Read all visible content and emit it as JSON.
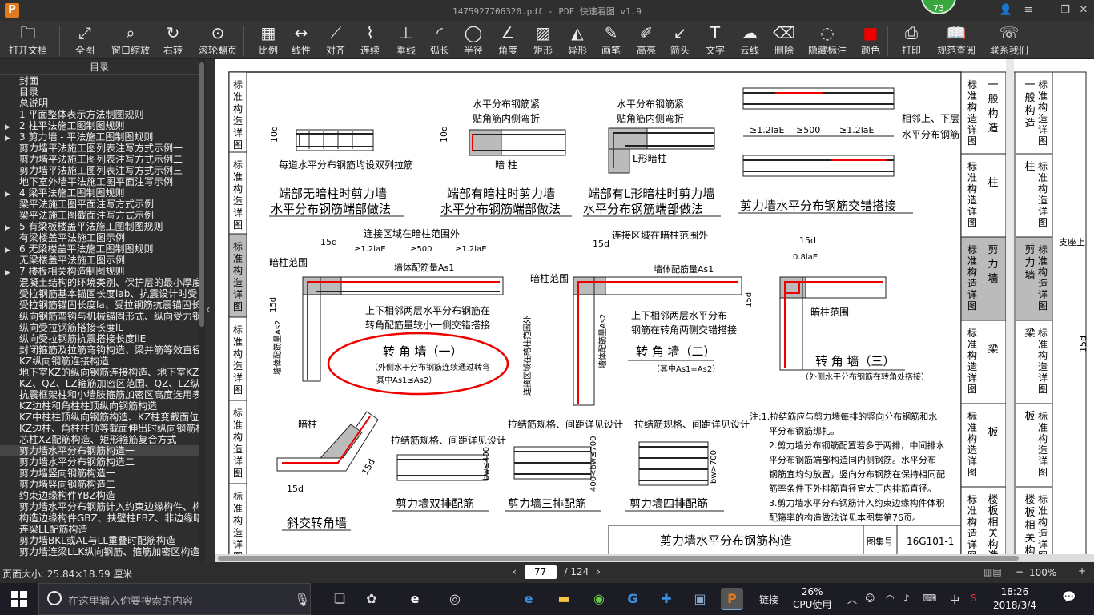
{
  "window": {
    "title": "1475927706320.pdf - PDF 快速看图 v1.9",
    "badge": "73"
  },
  "toolbar": [
    {
      "label": "打开文档",
      "icon": "folder-icon"
    },
    {
      "label": "全图",
      "icon": "fit-icon"
    },
    {
      "label": "窗口缩放",
      "icon": "zoom-icon"
    },
    {
      "label": "右转",
      "icon": "rotate-icon"
    },
    {
      "label": "滚轮翻页",
      "icon": "mouse-icon"
    },
    {
      "label": "比例",
      "icon": "ruler-icon"
    },
    {
      "label": "线性",
      "icon": "linear-icon"
    },
    {
      "label": "对齐",
      "icon": "align-icon"
    },
    {
      "label": "连续",
      "icon": "continuous-icon"
    },
    {
      "label": "垂线",
      "icon": "perpendicular-icon"
    },
    {
      "label": "弧长",
      "icon": "arc-icon"
    },
    {
      "label": "半径",
      "icon": "radius-icon"
    },
    {
      "label": "角度",
      "icon": "angle-icon"
    },
    {
      "label": "矩形",
      "icon": "rectangle-icon"
    },
    {
      "label": "异形",
      "icon": "polygon-icon"
    },
    {
      "label": "画笔",
      "icon": "pen-icon"
    },
    {
      "label": "高亮",
      "icon": "highlight-icon"
    },
    {
      "label": "箭头",
      "icon": "arrow-icon"
    },
    {
      "label": "文字",
      "icon": "text-icon"
    },
    {
      "label": "云线",
      "icon": "cloud-icon"
    },
    {
      "label": "删除",
      "icon": "eraser-icon"
    },
    {
      "label": "隐藏标注",
      "icon": "hide-icon"
    },
    {
      "label": "颜色",
      "icon": "color-icon"
    },
    {
      "label": "打印",
      "icon": "print-icon"
    },
    {
      "label": "规范查阅",
      "icon": "book-icon"
    },
    {
      "label": "联系我们",
      "icon": "contact-icon"
    }
  ],
  "toc": {
    "title": "目录",
    "items": [
      {
        "label": "封面",
        "exp": false
      },
      {
        "label": "目录",
        "exp": false
      },
      {
        "label": "总说明",
        "exp": false
      },
      {
        "label": "1 平面整体表示方法制图规则",
        "exp": false
      },
      {
        "label": "2 柱平法施工图制图规则",
        "exp": true
      },
      {
        "label": "3 剪力墙 - 平法施工图制图规则",
        "exp": true
      },
      {
        "label": "剪力墙平法施工图列表注写方式示例一",
        "exp": false
      },
      {
        "label": "剪力墙平法施工图列表注写方式示例二",
        "exp": false
      },
      {
        "label": "剪力墙平法施工图列表注写方式示例三",
        "exp": false
      },
      {
        "label": "地下室外墙平法施工图平面注写示例",
        "exp": false
      },
      {
        "label": "4 梁平法施工图制图规则",
        "exp": true
      },
      {
        "label": "梁平法施工图平面注写方式示例",
        "exp": false
      },
      {
        "label": "梁平法施工图截面注写方式示例",
        "exp": false
      },
      {
        "label": "5 有梁板楼盖平法施工图制图规则",
        "exp": true
      },
      {
        "label": "有梁楼盖平法施工图示例",
        "exp": false
      },
      {
        "label": "6 无梁楼盖平法施工图制图规则",
        "exp": true
      },
      {
        "label": "无梁楼盖平法施工图示例",
        "exp": false
      },
      {
        "label": "7 楼板相关构造制图规则",
        "exp": true
      },
      {
        "label": "混凝土结构的环境类别、保护层的最小厚度",
        "exp": false
      },
      {
        "label": "受拉钢筋基本锚固长度lab、抗震设计时受",
        "exp": false
      },
      {
        "label": "受拉钢筋锚固长度la、受拉钢筋抗震锚固长",
        "exp": false
      },
      {
        "label": "纵向钢筋弯钩与机械锚固形式、纵向受力钢",
        "exp": false
      },
      {
        "label": "纵向受拉钢筋搭接长度lL",
        "exp": false
      },
      {
        "label": "纵向受拉钢筋抗震搭接长度llE",
        "exp": false
      },
      {
        "label": "封闭箍筋及拉筋弯钩构造、梁并筋等效直径",
        "exp": false
      },
      {
        "label": "KZ纵向钢筋连接构造",
        "exp": false
      },
      {
        "label": "地下室KZ的纵向钢筋连接构造、地下室KZ的",
        "exp": false
      },
      {
        "label": "KZ、QZ、LZ箍筋加密区范围、QZ、LZ纵向钢",
        "exp": false
      },
      {
        "label": "抗震框架柱和小墙肢箍筋加密区高度选用表",
        "exp": false
      },
      {
        "label": "KZ边柱和角柱柱顶纵向钢筋构造",
        "exp": false
      },
      {
        "label": "KZ中柱柱顶纵向钢筋构造、KZ柱变截面位置",
        "exp": false
      },
      {
        "label": "KZ边柱、角柱柱顶等截面伸出时纵向钢筋构",
        "exp": false
      },
      {
        "label": "芯柱XZ配筋构造、矩形箍筋复合方式",
        "exp": false
      },
      {
        "label": "剪力墙水平分布钢筋构造一",
        "exp": false,
        "sel": true
      },
      {
        "label": "剪力墙水平分布钢筋构造二",
        "exp": false
      },
      {
        "label": "剪力墙竖向钢筋构造一",
        "exp": false
      },
      {
        "label": "剪力墙竖向钢筋构造二",
        "exp": false
      },
      {
        "label": "约束边缘构件YBZ构造",
        "exp": false
      },
      {
        "label": "剪力墙水平分布钢筋计入约束边缘构件、构",
        "exp": false
      },
      {
        "label": "构造边缘构件GBZ、扶壁柱FBZ、非边缘暗柱",
        "exp": false
      },
      {
        "label": "连梁LL配筋构造",
        "exp": false
      },
      {
        "label": "剪力墙BKL或AL与LL重叠时配筋构造",
        "exp": false
      },
      {
        "label": "剪力墙连梁LLK纵向钢筋、箍筋加密区构造",
        "exp": false
      }
    ]
  },
  "drawing": {
    "side_tabs": [
      "标准构造详图",
      "标准构造详图",
      "标准构造详图",
      "标准构造详图",
      "标准构造详图",
      "标准构造详图"
    ],
    "right_tabs": [
      {
        "group": "标准构造详图",
        "name": "一般构造"
      },
      {
        "group": "标准构造详图",
        "name": "柱"
      },
      {
        "group": "标准构造详图",
        "name": "剪力墙"
      },
      {
        "group": "标准构造详图",
        "name": "梁"
      },
      {
        "group": "标准构造详图",
        "name": "板"
      },
      {
        "group": "标准构造详图",
        "name": "楼板相关构造"
      }
    ],
    "far_right_tabs": [
      "一般构造",
      "柱",
      "剪力墙",
      "梁",
      "板",
      "楼板相关构"
    ],
    "far_right_side": "支座上",
    "far_right_dim": "15d",
    "captions": {
      "c1a": "端部无暗柱时剪力墙",
      "c1b": "水平分布钢筋端部做法",
      "c2a": "端部有暗柱时剪力墙",
      "c2b": "水平分布钢筋端部做法",
      "c3a": "端部有L形暗柱时剪力墙",
      "c3b": "水平分布钢筋端部做法",
      "c4": "剪力墙水平分布钢筋交错搭接",
      "c5": "转 角 墙（一）",
      "c5n1": "（外侧水平分布钢筋连续通过转弯",
      "c5n2": "其中As1≤As2）",
      "c6": "转 角 墙（二）",
      "c6n": "（其中As1=As2）",
      "c7": "转 角 墙（三）",
      "c7n": "（外侧水平分布钢筋在转角处搭接）",
      "c8": "斜交转角墙",
      "c9": "剪力墙双排配筋",
      "c10": "剪力墙三排配筋",
      "c11": "剪力墙四排配筋"
    },
    "labels": {
      "l1": "每道水平分布钢筋均设双列拉筋",
      "l2a": "水平分布钢筋紧",
      "l2b": "贴角筋内侧弯折",
      "l2c": "暗 柱",
      "l3a": "水平分布钢筋紧",
      "l3b": "贴角筋内侧弯折",
      "l3c": "L形暗柱",
      "l4a": "相邻上、下层",
      "l4b": "水平分布钢筋",
      "dim1": "≥1.2laE",
      "dim2": "≥500",
      "dim3": "≥1.2laE",
      "l5a": "连接区域在暗柱范围外",
      "l5b": "暗柱范围",
      "l5c": "墙体配筋量As1",
      "l5d": "墙体配筋量As2",
      "l5e": "上下相邻两层水平分布钢筋在",
      "l5f": "转角配筋量较小一侧交错搭接",
      "l6a": "连接区域在暗柱范围外",
      "l6b": "暗柱范围",
      "l6c": "墙体配筋量As1",
      "l6d": "墙体配筋量As2",
      "l6e": "上下相邻两层水平分布",
      "l6f": "钢筋在转角两侧交错搭接",
      "l6g": "连接区域在暗柱范围外",
      "l7a": "暗柱范围",
      "l7b": "0.8laE",
      "l8": "暗柱",
      "l9": "拉结筋规格、间距详见设计",
      "l10": "拉结筋规格、间距详见设计",
      "l11": "拉结筋规格、间距详见设计",
      "bw1": "bw≤400",
      "bw2": "400<bw≤700",
      "bw3": "bw>700",
      "d10": "10d",
      "d15": "15d"
    },
    "notes": [
      "注:1.拉结筋应与剪力墙每排的竖向分布钢筋和水",
      "平分布钢筋绑扎。",
      "2.剪力墙分布钢筋配置若多于两排，中间排水",
      "平分布钢筋端部构造同内侧钢筋。水平分布",
      "钢筋宜均匀放置，竖向分布钢筋在保持相同配",
      "筋率条件下外排筋直径宜大于内排筋直径。",
      "3.剪力墙水平分布钢筋计入约束边缘构件体积",
      "配箍率的构造做法详见本图集第76页。"
    ],
    "title_block": {
      "title": "剪力墙水平分布钢筋构造",
      "atlas_label": "图集号",
      "atlas_no": "16G101-1"
    }
  },
  "status": {
    "page_size": "页面大小: 25.84×18.59 厘米",
    "page": "77",
    "total": "/ 124",
    "zoom": "100%"
  },
  "taskbar": {
    "search_placeholder": "在这里输入你要搜索的内容",
    "link": "链接",
    "cpu_pct": "26%",
    "cpu_label": "CPU使用",
    "ime": "中",
    "time": "18:26",
    "date": "2018/3/4"
  }
}
